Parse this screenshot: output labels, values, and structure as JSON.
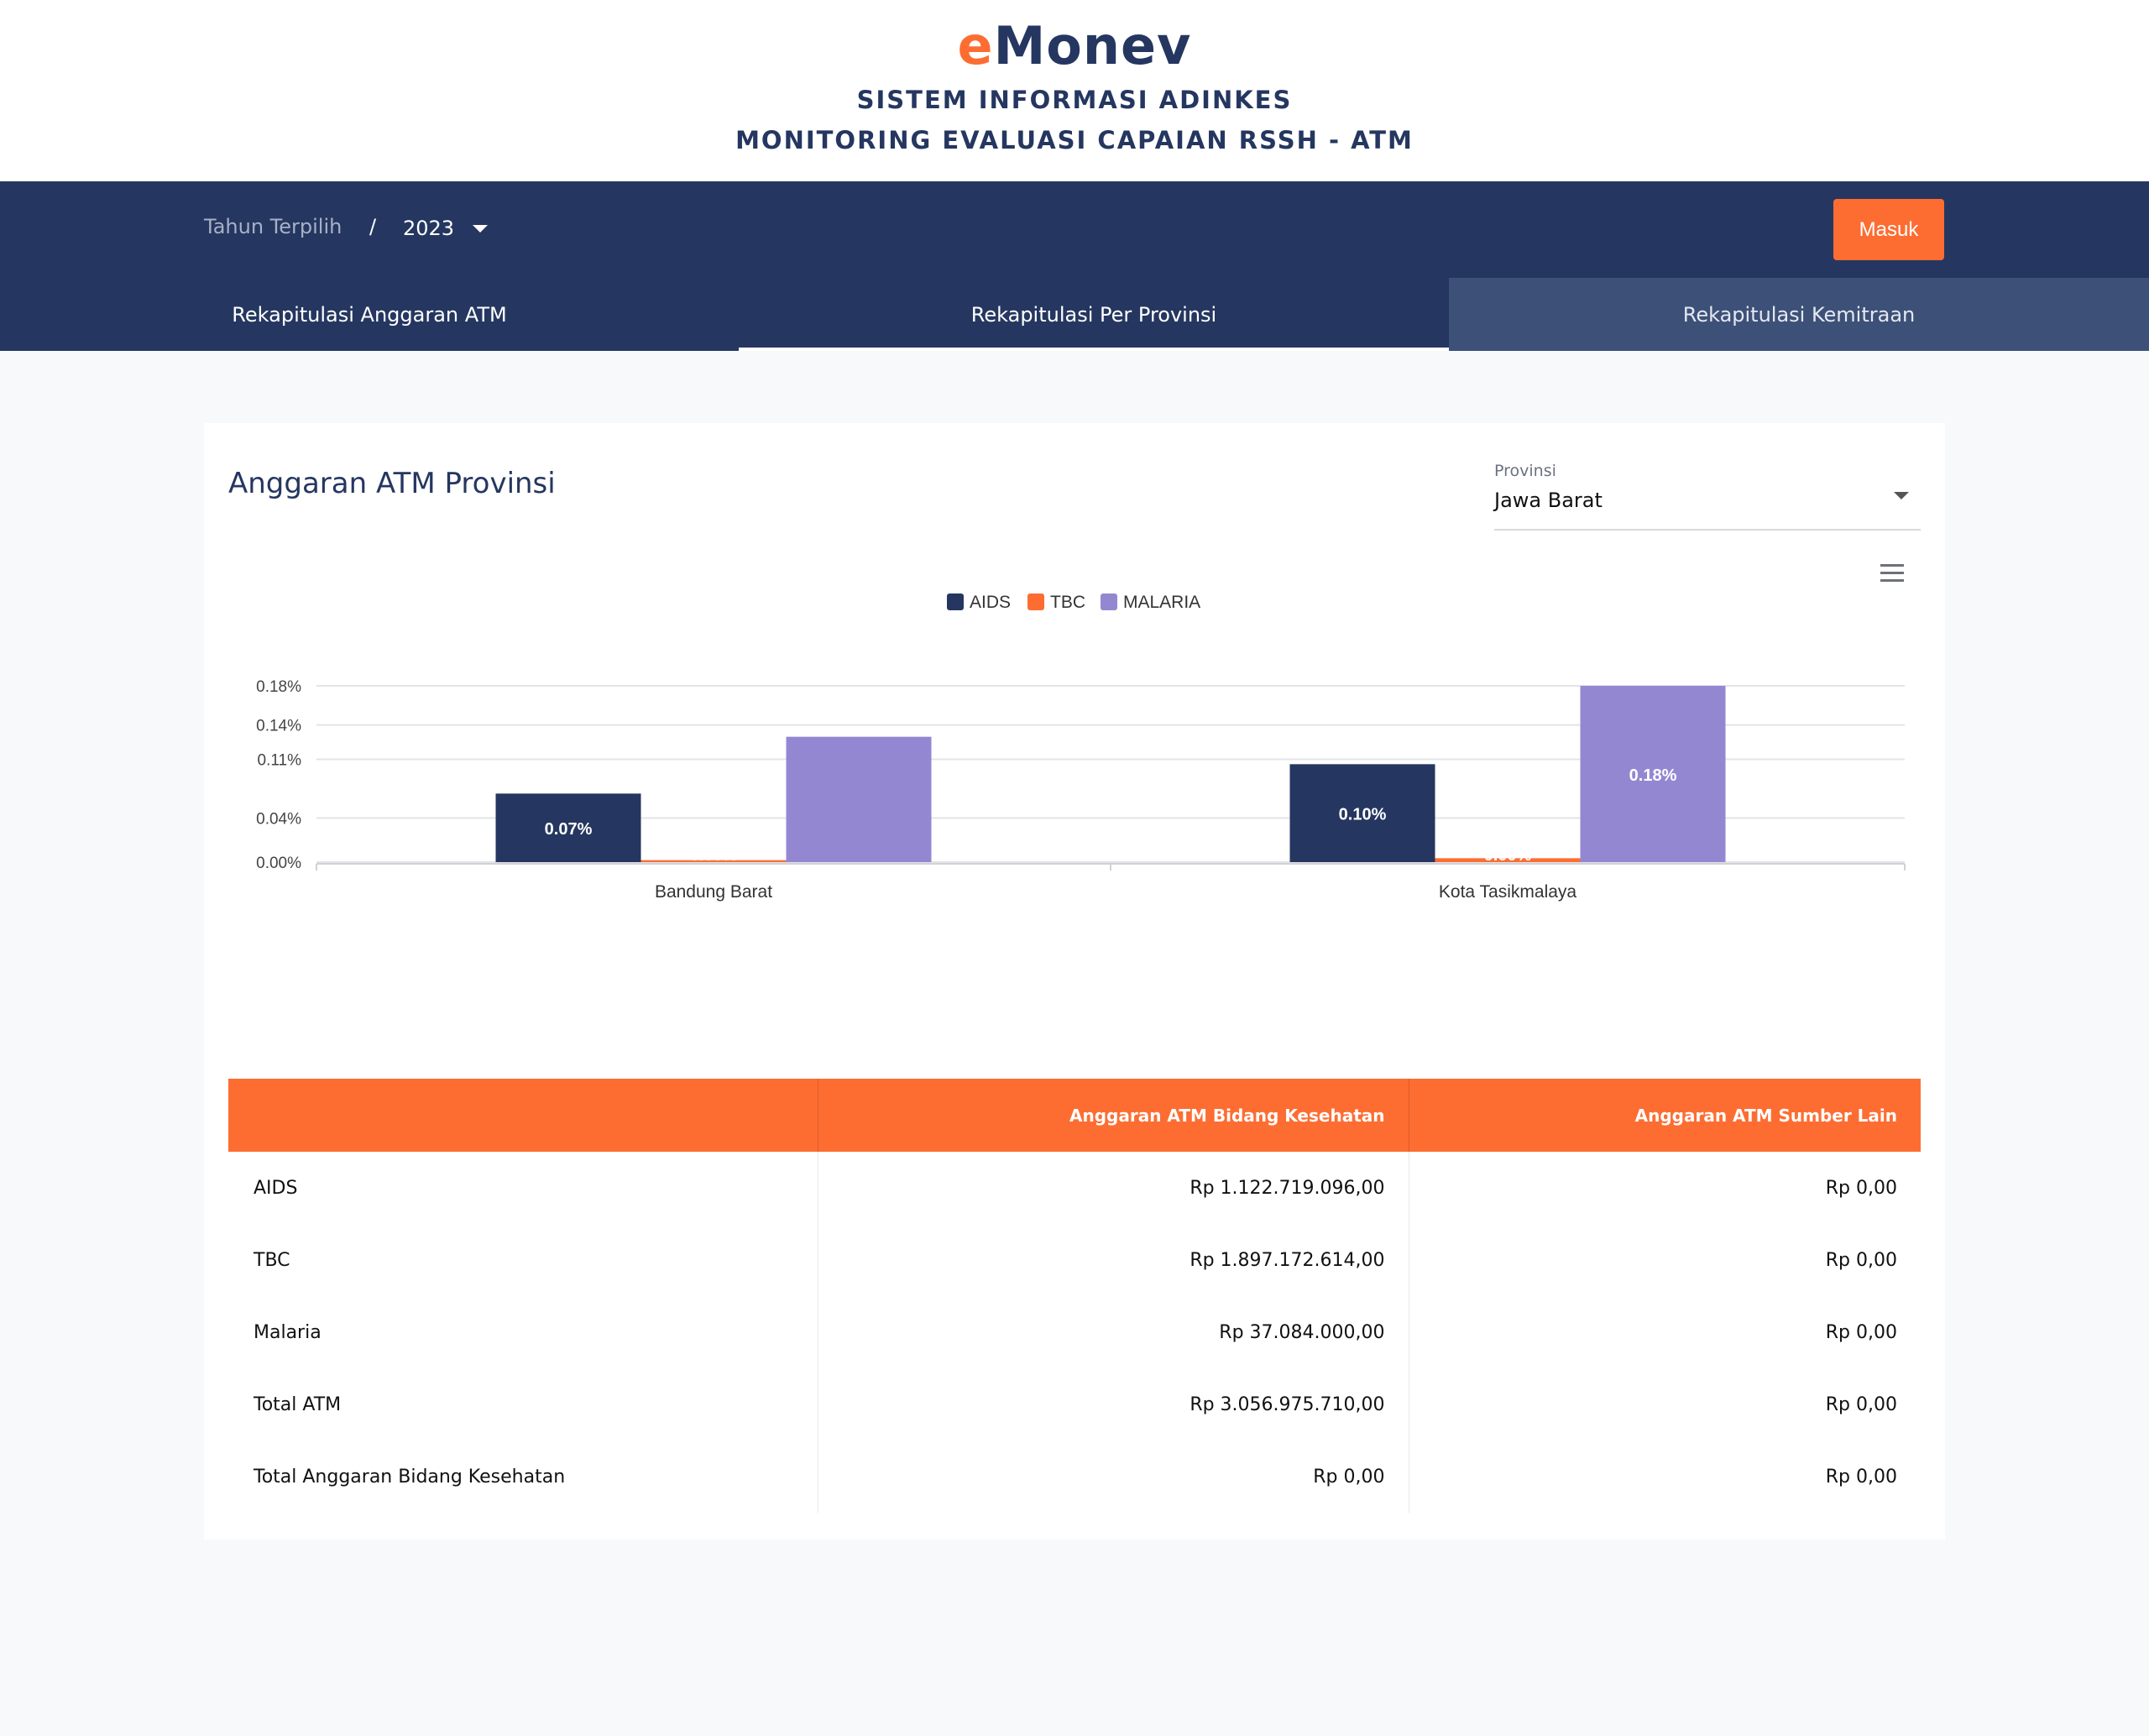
{
  "header": {
    "logo_e": "e",
    "logo_rest": "Monev",
    "subtitle1": "SISTEM INFORMASI ADINKES",
    "subtitle2": "MONITORING EVALUASI CAPAIAN RSSH - ATM"
  },
  "navbar": {
    "year_label": "Tahun Terpilih",
    "separator": "/",
    "year_value": "2023",
    "login_label": "Masuk"
  },
  "tabs": [
    {
      "label": "Rekapitulasi Anggaran ATM"
    },
    {
      "label": "Rekapitulasi Per Provinsi"
    },
    {
      "label": "Rekapitulasi Kemitraan"
    }
  ],
  "card": {
    "title": "Anggaran ATM Provinsi",
    "province_label": "Provinsi",
    "province_value": "Jawa Barat"
  },
  "chart_data": {
    "type": "bar",
    "categories": [
      "Bandung Barat",
      "Kota Tasikmalaya"
    ],
    "series": [
      {
        "name": "AIDS",
        "color": "#253760",
        "values": [
          0.07,
          0.1
        ],
        "labels": [
          "0.07%",
          "0.10%"
        ]
      },
      {
        "name": "TBC",
        "color": "#fd6d32",
        "values": [
          0.002,
          0.004
        ],
        "labels": [
          "0.00%",
          "0.00%"
        ]
      },
      {
        "name": "MALARIA",
        "color": "#9487d2",
        "values": [
          0.128,
          0.18
        ],
        "labels": [
          "",
          "0.18%"
        ]
      }
    ],
    "yticks": [
      {
        "value": 0,
        "label": "0.00%"
      },
      {
        "value": 0.045,
        "label": "0.04%"
      },
      {
        "value": 0.105,
        "label": "0.11%"
      },
      {
        "value": 0.14,
        "label": "0.14%"
      },
      {
        "value": 0.18,
        "label": "0.18%"
      }
    ],
    "ylim": [
      0,
      0.18
    ],
    "legend_position": "top-center",
    "grid": true
  },
  "table": {
    "headers": [
      "",
      "Anggaran ATM Bidang Kesehatan",
      "Anggaran ATM Sumber Lain"
    ],
    "rows": [
      [
        "AIDS",
        "Rp 1.122.719.096,00",
        "Rp 0,00"
      ],
      [
        "TBC",
        "Rp 1.897.172.614,00",
        "Rp 0,00"
      ],
      [
        "Malaria",
        "Rp 37.084.000,00",
        "Rp 0,00"
      ],
      [
        "Total ATM",
        "Rp 3.056.975.710,00",
        "Rp 0,00"
      ],
      [
        "Total Anggaran Bidang Kesehatan",
        "Rp 0,00",
        "Rp 0,00"
      ]
    ]
  }
}
